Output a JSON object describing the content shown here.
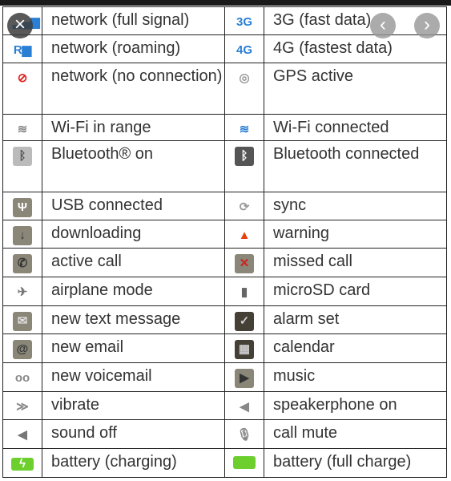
{
  "viewer": {
    "close_icon": "×",
    "prev_icon": "‹",
    "next_icon": "›"
  },
  "rows": [
    {
      "h": 35,
      "l": {
        "icon": "signal-full-icon",
        "glyph": "▂▄▆",
        "bg": "transparent",
        "fg": "#2a7fd4",
        "text": "network (full signal)"
      },
      "r": {
        "icon": "3g-icon",
        "glyph": "3G",
        "bg": "transparent",
        "fg": "#2a7fd4",
        "text": "3G (fast data)"
      }
    },
    {
      "h": 35,
      "l": {
        "icon": "signal-roaming-icon",
        "glyph": "R▆",
        "bg": "transparent",
        "fg": "#2a7fd4",
        "text": "network (roaming)"
      },
      "r": {
        "icon": "4g-icon",
        "glyph": "4G",
        "bg": "transparent",
        "fg": "#2a7fd4",
        "text": "4G (fastest data)"
      }
    },
    {
      "h": 64,
      "l": {
        "icon": "signal-no-connection-icon",
        "glyph": "⊘",
        "bg": "transparent",
        "fg": "#e02020",
        "text": "network (no connection)"
      },
      "r": {
        "icon": "gps-icon",
        "glyph": "◎",
        "bg": "transparent",
        "fg": "#999",
        "text": "GPS active"
      }
    },
    {
      "h": 33,
      "l": {
        "icon": "wifi-in-range-icon",
        "glyph": "≋",
        "bg": "transparent",
        "fg": "#888",
        "text": "Wi-Fi in range"
      },
      "r": {
        "icon": "wifi-connected-icon",
        "glyph": "≋",
        "bg": "transparent",
        "fg": "#2a7fd4",
        "text": "Wi-Fi connected"
      }
    },
    {
      "h": 64,
      "l": {
        "icon": "bluetooth-on-icon",
        "glyph": "ᛒ",
        "bg": "#bbb",
        "fg": "#555",
        "text": "Bluetooth® on"
      },
      "r": {
        "icon": "bluetooth-connected-icon",
        "glyph": "ᛒ",
        "bg": "#555",
        "fg": "#fff",
        "text": "Bluetooth connected"
      }
    },
    {
      "h": 35,
      "l": {
        "icon": "usb-icon",
        "glyph": "Ψ",
        "bg": "#8a8778",
        "fg": "#fff",
        "text": "USB connected"
      },
      "r": {
        "icon": "sync-icon",
        "glyph": "⟳",
        "bg": "transparent",
        "fg": "#999",
        "text": "sync"
      }
    },
    {
      "h": 35,
      "l": {
        "icon": "download-icon",
        "glyph": "↓",
        "bg": "#8a8778",
        "fg": "#333",
        "text": "downloading"
      },
      "r": {
        "icon": "warning-icon",
        "glyph": "▲",
        "bg": "transparent",
        "fg": "#e8400c",
        "text": "warning"
      }
    },
    {
      "h": 36,
      "l": {
        "icon": "phone-icon",
        "glyph": "✆",
        "bg": "#8a8778",
        "fg": "#333",
        "text": "active call"
      },
      "r": {
        "icon": "missed-call-icon",
        "glyph": "✕",
        "bg": "#8a8778",
        "fg": "#d02020",
        "text": "missed call"
      }
    },
    {
      "h": 36,
      "l": {
        "icon": "airplane-icon",
        "glyph": "✈",
        "bg": "transparent",
        "fg": "#777",
        "text": "airplane mode"
      },
      "r": {
        "icon": "microsd-icon",
        "glyph": "▮",
        "bg": "transparent",
        "fg": "#666",
        "text": "microSD card"
      }
    },
    {
      "h": 35,
      "l": {
        "icon": "envelope-icon",
        "glyph": "✉",
        "bg": "#8a8778",
        "fg": "#ddd",
        "text": "new text message"
      },
      "r": {
        "icon": "alarm-icon",
        "glyph": "✓",
        "bg": "#444036",
        "fg": "#ccc",
        "text": "alarm set"
      }
    },
    {
      "h": 36,
      "l": {
        "icon": "email-icon",
        "glyph": "@",
        "bg": "#8a8778",
        "fg": "#333",
        "text": "new email"
      },
      "r": {
        "icon": "calendar-icon",
        "glyph": "▦",
        "bg": "#444036",
        "fg": "#ccc",
        "text": "calendar"
      }
    },
    {
      "h": 36,
      "l": {
        "icon": "voicemail-icon",
        "glyph": "oo",
        "bg": "transparent",
        "fg": "#888",
        "text": "new voicemail"
      },
      "r": {
        "icon": "music-icon",
        "glyph": "▶",
        "bg": "#8a8778",
        "fg": "#333",
        "text": "music"
      }
    },
    {
      "h": 35,
      "l": {
        "icon": "vibrate-icon",
        "glyph": "≫",
        "bg": "transparent",
        "fg": "#888",
        "text": "vibrate"
      },
      "r": {
        "icon": "speaker-icon",
        "glyph": "◀",
        "bg": "transparent",
        "fg": "#888",
        "text": "speakerphone on"
      }
    },
    {
      "h": 36,
      "l": {
        "icon": "sound-off-icon",
        "glyph": "◀",
        "bg": "transparent",
        "fg": "#777",
        "text": "sound off"
      },
      "r": {
        "icon": "mic-mute-icon",
        "glyph": "🎙",
        "bg": "transparent",
        "fg": "#888",
        "text": "call mute"
      }
    },
    {
      "h": 36,
      "l": {
        "icon": "battery-charging-icon",
        "glyph": "ϟ",
        "bg": "#6ccf2e",
        "fg": "#fff",
        "text": "battery (charging)"
      },
      "r": {
        "icon": "battery-full-icon",
        "glyph": "",
        "bg": "#6ccf2e",
        "fg": "#fff",
        "text": "battery (full charge)"
      }
    }
  ]
}
